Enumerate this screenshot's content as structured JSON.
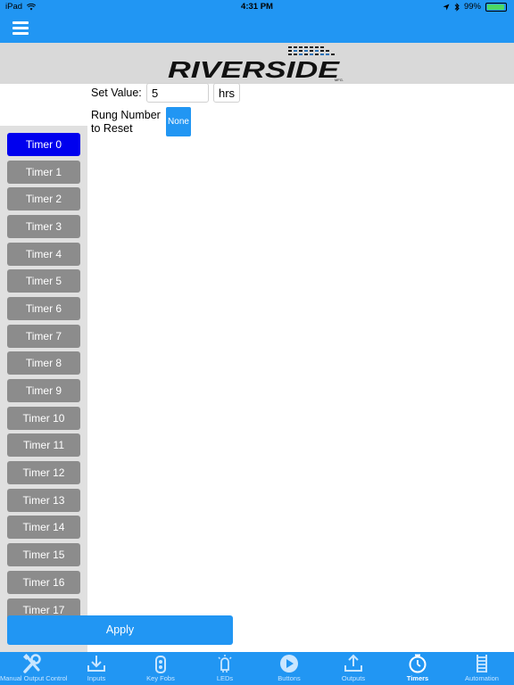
{
  "status_bar": {
    "device": "iPad",
    "time": "4:31 PM",
    "battery_percent": "99%",
    "battery_level": 0.99,
    "icons": [
      "wifi-icon",
      "location-icon",
      "bluetooth-icon",
      "battery-icon"
    ]
  },
  "app_bar": {
    "menu_icon": "hamburger-menu-icon"
  },
  "logo": {
    "text": "RIVERSIDE",
    "sub": "MFG."
  },
  "form": {
    "set_value_label": "Set Value:",
    "set_value": "5",
    "unit": "hrs",
    "rung_label_line1": "Rung Number",
    "rung_label_line2": "to Reset",
    "rung_value": "None"
  },
  "timers": [
    "Timer 0",
    "Timer 1",
    "Timer 2",
    "Timer 3",
    "Timer 4",
    "Timer 5",
    "Timer 6",
    "Timer 7",
    "Timer 8",
    "Timer 9",
    "Timer 10",
    "Timer 11",
    "Timer 12",
    "Timer 13",
    "Timer 14",
    "Timer 15",
    "Timer 16",
    "Timer 17"
  ],
  "selected_timer": "Timer 0",
  "apply_label": "Apply",
  "tabs": [
    {
      "label": "Manual Output Control",
      "icon": "tools-icon"
    },
    {
      "label": "Inputs",
      "icon": "download-icon"
    },
    {
      "label": "Key Fobs",
      "icon": "key-fob-icon"
    },
    {
      "label": "LEDs",
      "icon": "led-icon"
    },
    {
      "label": "Buttons",
      "icon": "play-button-icon"
    },
    {
      "label": "Outputs",
      "icon": "upload-icon"
    },
    {
      "label": "Timers",
      "icon": "stopwatch-icon"
    },
    {
      "label": "Automation",
      "icon": "ladder-icon"
    }
  ],
  "active_tab": "Timers",
  "colors": {
    "primary": "#2196f3",
    "selected_timer": "#0000ee",
    "timer_button": "#8c8c8c",
    "sidebar": "#e0e0e0",
    "logo_band": "#d9d9d9"
  }
}
